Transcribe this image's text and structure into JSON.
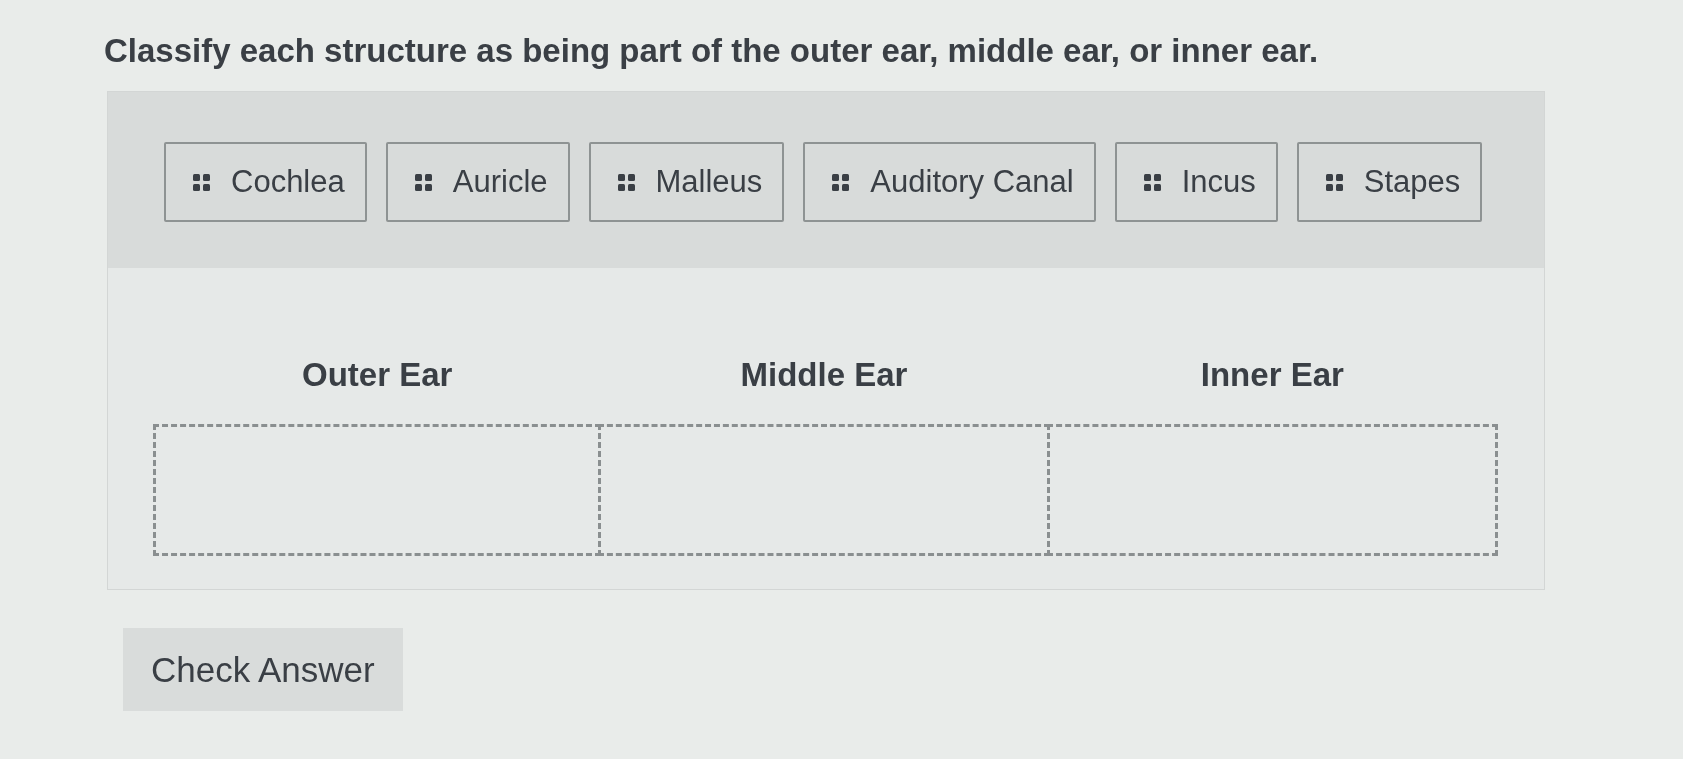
{
  "question": "Classify each structure as being part of the outer ear, middle ear, or inner ear.",
  "items": [
    {
      "label": "Cochlea"
    },
    {
      "label": "Auricle"
    },
    {
      "label": "Malleus"
    },
    {
      "label": "Auditory Canal"
    },
    {
      "label": "Incus"
    },
    {
      "label": "Stapes"
    }
  ],
  "categories": [
    {
      "label": "Outer Ear"
    },
    {
      "label": "Middle Ear"
    },
    {
      "label": "Inner Ear"
    }
  ],
  "check_button": {
    "label": "Check Answer"
  }
}
